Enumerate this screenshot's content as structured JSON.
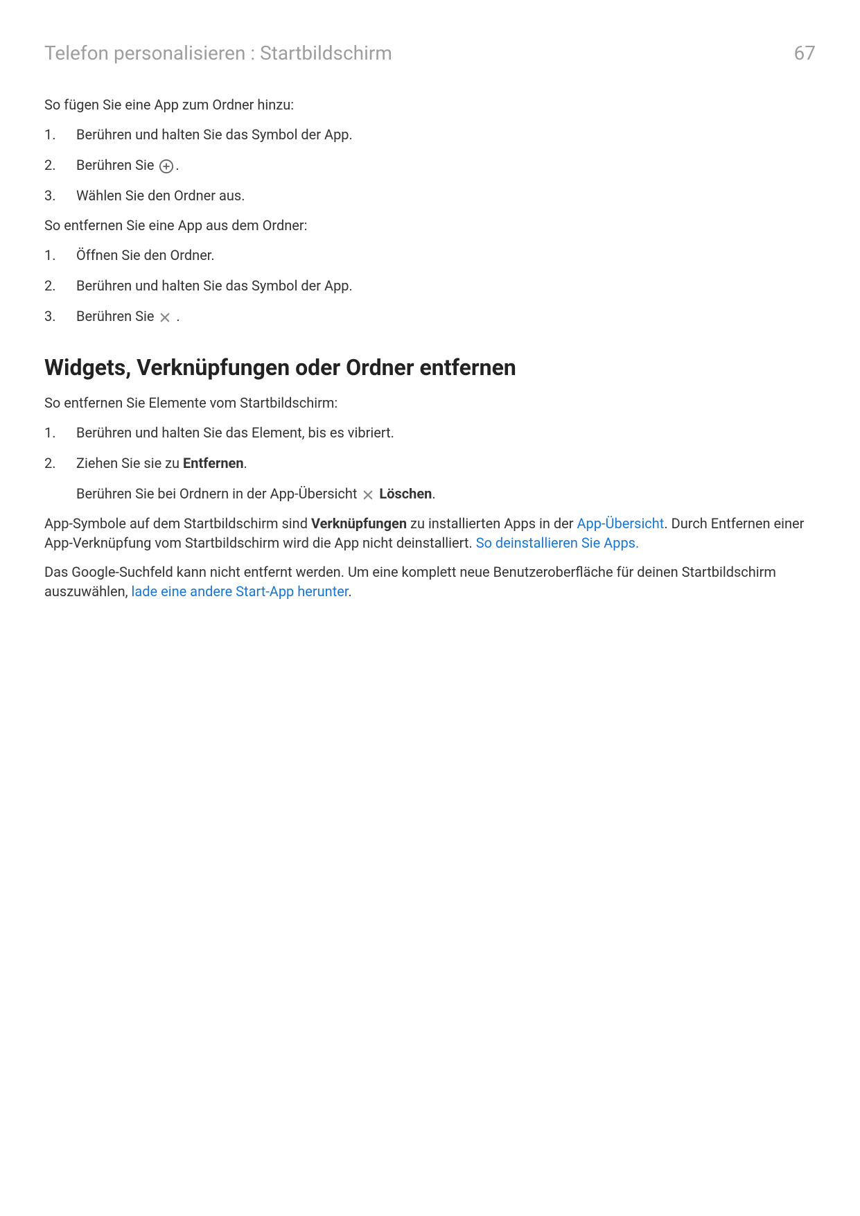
{
  "header": {
    "breadcrumb": "Telefon personalisieren : Startbildschirm",
    "page_number": "67"
  },
  "section_add": {
    "intro": "So fügen Sie eine App zum Ordner hinzu:",
    "step1": "Berühren und halten Sie das Symbol der App.",
    "step2_before": "Berühren Sie ",
    "step2_after": ".",
    "step3": "Wählen Sie den Ordner aus."
  },
  "section_remove_app": {
    "intro": "So entfernen Sie eine App aus dem Ordner:",
    "step1": "Öffnen Sie den Ordner.",
    "step2": "Berühren und halten Sie das Symbol der App.",
    "step3_before": "Berühren Sie ",
    "step3_after": " ."
  },
  "heading_remove": "Widgets, Verknüpfungen oder Ordner entfernen",
  "section_remove_items": {
    "intro": "So entfernen Sie Elemente vom Startbildschirm:",
    "step1": "Berühren und halten Sie das Element, bis es vibriert.",
    "step2_before": "Ziehen Sie sie zu ",
    "step2_bold": "Entfernen",
    "step2_after": ".",
    "sub_before": "Berühren Sie bei Ordnern in der App-Übersicht ",
    "sub_bold": "Löschen",
    "sub_after": "."
  },
  "para_shortcuts": {
    "t1": "App-Symbole auf dem Startbildschirm sind ",
    "b1": "Verknüpfungen",
    "t2": " zu installierten Apps in der ",
    "link1": "App-Übersicht",
    "t3": ". Durch Entfernen einer App-Verknüpfung vom Startbildschirm wird die App nicht deinstalliert. ",
    "link2": "So deinstallieren Sie Apps."
  },
  "para_google": {
    "t1": "Das Google-Suchfeld kann nicht entfernt werden. Um eine komplett neue Benutzeroberfläche für deinen Startbildschirm auszuwählen, ",
    "link1": "lade eine andere Start-App herunter",
    "t2": "."
  }
}
